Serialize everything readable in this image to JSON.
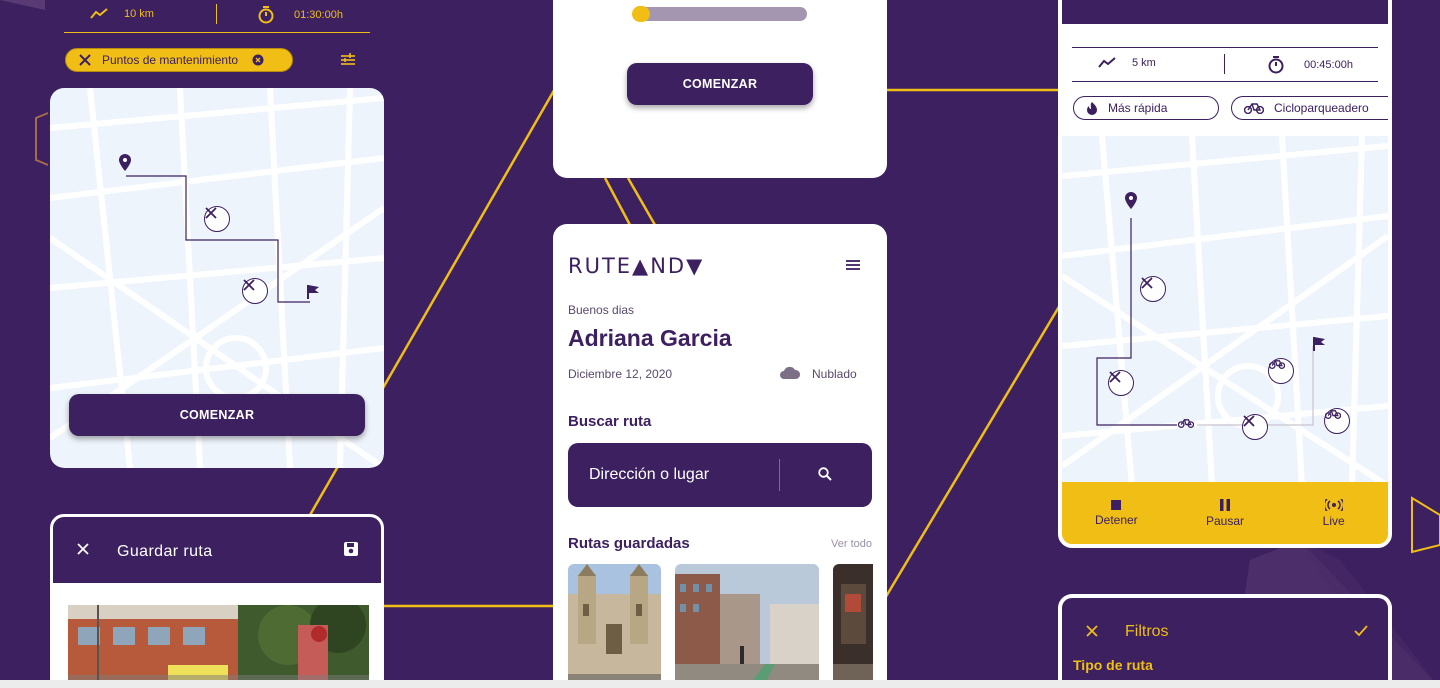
{
  "colors": {
    "brand_purple": "#3c2060",
    "accent_yellow": "#f0be14",
    "map_bg": "#eef4fb"
  },
  "left_card": {
    "distance": "10 km",
    "time": "01:30:00h",
    "chip_label": "Puntos de mantenimiento",
    "start_button": "COMENZAR"
  },
  "save_card": {
    "title": "Guardar ruta"
  },
  "top_center_card": {
    "progress_percent": 3,
    "start_button": "COMENZAR"
  },
  "home_card": {
    "logo_text": "RUTE▲ND▼",
    "greeting": "Buenos dias",
    "user_name": "Adriana Garcia",
    "date": "Diciembre 12, 2020",
    "weather": "Nublado",
    "search_heading": "Buscar ruta",
    "search_placeholder": "Dirección o lugar",
    "saved_heading": "Rutas guardadas",
    "see_all": "Ver todo"
  },
  "right_card": {
    "distance": "5 km",
    "time": "00:45:00h",
    "chip_fast": "Más rápida",
    "chip_bike": "Cicloparqueadero",
    "controls": [
      {
        "label": "Detener",
        "icon": "stop-icon"
      },
      {
        "label": "Pausar",
        "icon": "pause-icon"
      },
      {
        "label": "Live",
        "icon": "live-icon"
      }
    ]
  },
  "filters_card": {
    "title": "Filtros",
    "section": "Tipo de ruta"
  }
}
